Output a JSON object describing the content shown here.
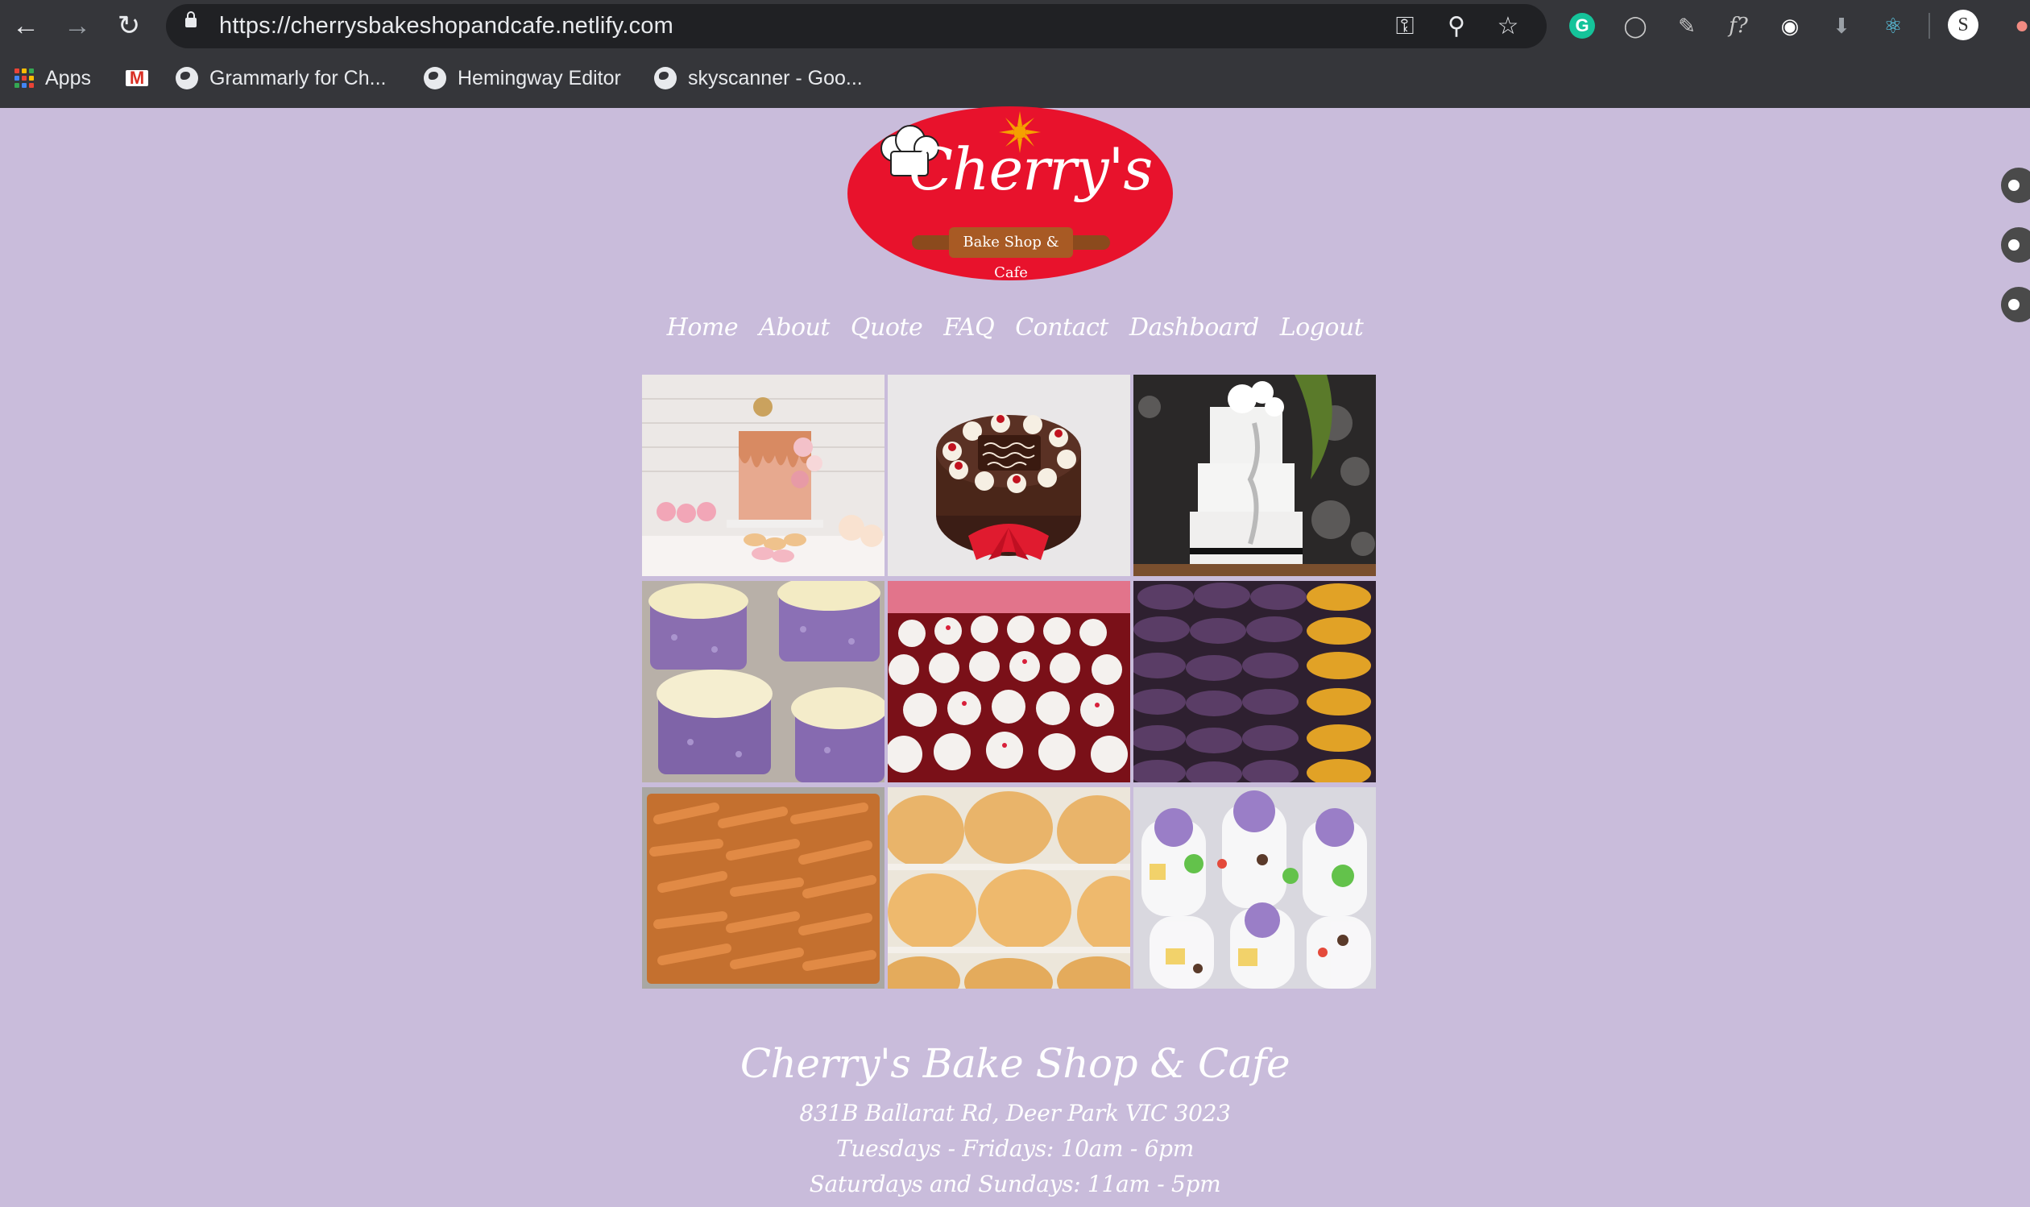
{
  "browser": {
    "url": "https://cherrysbakeshopandcafe.netlify.com",
    "profile_initial": "S",
    "bookmarks": [
      {
        "label": "Apps",
        "icon": "apps-grid-icon"
      },
      {
        "label": "",
        "icon": "gmail-icon"
      },
      {
        "label": "Grammarly for Ch...",
        "icon": "globe-icon"
      },
      {
        "label": "Hemingway Editor",
        "icon": "globe-icon"
      },
      {
        "label": "skyscanner - Goo...",
        "icon": "globe-icon"
      }
    ]
  },
  "logo": {
    "name": "Cherry's",
    "tagline": "Bake Shop & Cafe",
    "colors": {
      "oval": "#e8122c",
      "rolling_pin": "#8b4a1d",
      "sun": "#f5a000"
    }
  },
  "nav": {
    "items": [
      "Home",
      "About",
      "Quote",
      "FAQ",
      "Contact",
      "Dashboard",
      "Logout"
    ]
  },
  "gallery": {
    "tiles": [
      {
        "subject": "drip-cake-dessert-table"
      },
      {
        "subject": "black-forest-birthday-cake",
        "inscription": "Happy Birthday Michael!"
      },
      {
        "subject": "white-wedding-cake"
      },
      {
        "subject": "purple-sprinkle-cupcake-cakes"
      },
      {
        "subject": "red-velvet-cupcakes"
      },
      {
        "subject": "purple-and-yellow-macarons"
      },
      {
        "subject": "spring-rolls-tray"
      },
      {
        "subject": "bread-buns"
      },
      {
        "subject": "halo-halo-desserts"
      }
    ]
  },
  "footer": {
    "title": "Cherry's Bake Shop & Cafe",
    "address": "831B Ballarat Rd, Deer Park VIC 3023",
    "hours_weekdays": "Tuesdays - Fridays: 10am - 6pm",
    "hours_weekend": "Saturdays and Sundays: 11am - 5pm"
  },
  "colors": {
    "page_background": "#c9bcdb",
    "chrome_background": "#35363a",
    "text": "#ffffff"
  }
}
